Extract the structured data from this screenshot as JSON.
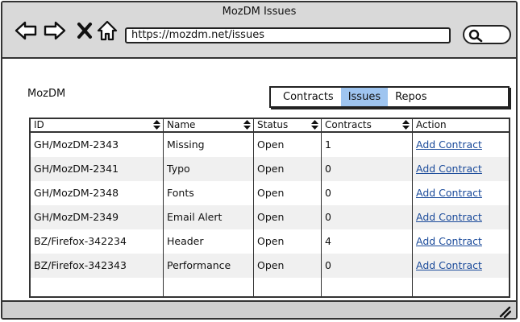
{
  "window": {
    "title": "MozDM Issues"
  },
  "browser": {
    "url": "https://mozdm.net/issues",
    "icons": [
      "back-arrow-icon",
      "forward-arrow-icon",
      "close-icon",
      "home-icon",
      "search-icon"
    ]
  },
  "app": {
    "name": "MozDM"
  },
  "tabs": [
    {
      "label": "Contracts",
      "active": false
    },
    {
      "label": "Issues",
      "active": true
    },
    {
      "label": "Repos",
      "active": false
    }
  ],
  "table": {
    "columns": [
      "ID",
      "Name",
      "Status",
      "Contracts",
      "Action"
    ],
    "rows": [
      {
        "id": "GH/MozDM-2343",
        "name": "Missing",
        "status": "Open",
        "contracts": "1",
        "action": "Add Contract"
      },
      {
        "id": "GH/MozDM-2341",
        "name": "Typo",
        "status": "Open",
        "contracts": "0",
        "action": "Add Contract"
      },
      {
        "id": "GH/MozDM-2348",
        "name": "Fonts",
        "status": "Open",
        "contracts": "0",
        "action": "Add Contract"
      },
      {
        "id": "GH/MozDM-2349",
        "name": "Email Alert",
        "status": "Open",
        "contracts": "0",
        "action": "Add Contract"
      },
      {
        "id": "BZ/Firefox-342234",
        "name": "Header",
        "status": "Open",
        "contracts": "4",
        "action": "Add Contract"
      },
      {
        "id": "BZ/Firefox-342343",
        "name": "Performance",
        "status": "Open",
        "contracts": "0",
        "action": "Add Contract"
      }
    ]
  },
  "colors": {
    "active_tab": "#9fc5f0",
    "link": "#1a4a9a",
    "chrome": "#d9d9d9"
  }
}
